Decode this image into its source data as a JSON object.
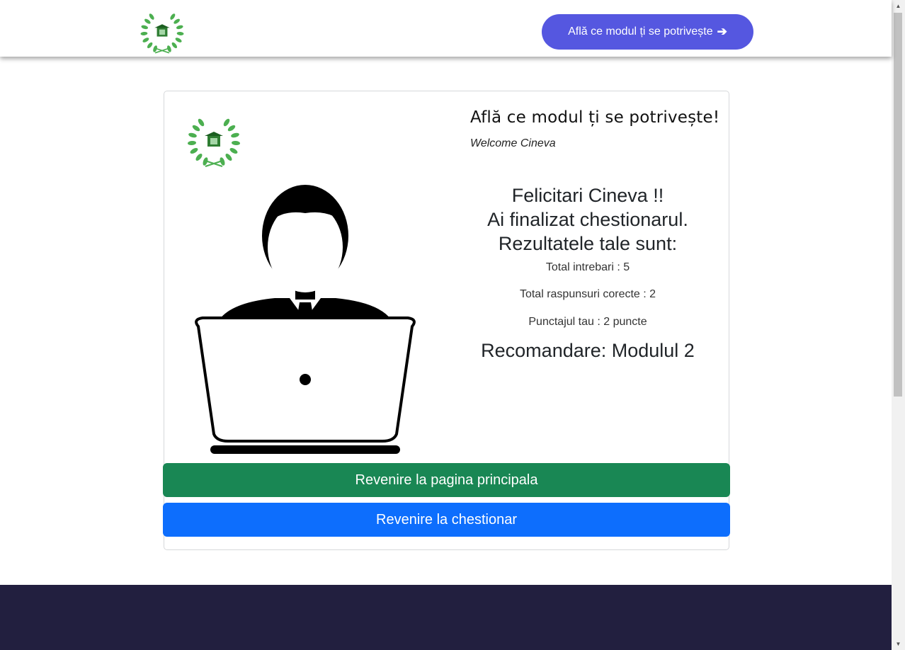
{
  "header": {
    "cta_label": "Află ce modul ți se potrivește",
    "cta_icon": "arrow-right-icon"
  },
  "card": {
    "title": "Află ce modul ți se potrivește!",
    "welcome": "Welcome Cineva",
    "results": {
      "line1": "Felicitari Cineva !!",
      "line2": "Ai finalizat chestionarul.",
      "line3": "Rezultatele tale sunt:",
      "total_questions": "Total intrebari : 5",
      "correct_answers": "Total raspunsuri corecte : 2",
      "score": "Punctajul tau : 2 puncte",
      "recommendation": "Recomandare: Modulul 2"
    },
    "buttons": {
      "main_page": "Revenire la pagina principala",
      "questionnaire": "Revenire la chestionar"
    }
  },
  "colors": {
    "cta": "#5557e0",
    "main_button": "#198754",
    "quiz_button": "#0d6efd",
    "footer": "#221f3f",
    "logo_green": "#4caf50"
  }
}
